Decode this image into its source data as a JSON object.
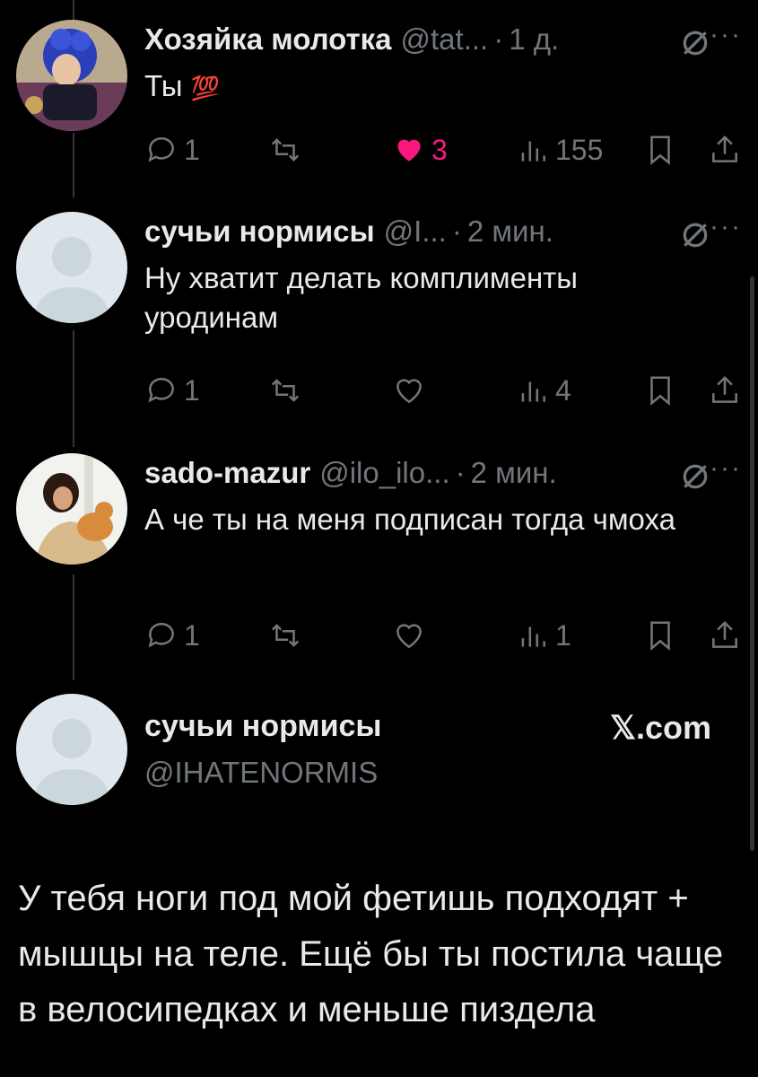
{
  "tweets": [
    {
      "name": "Хозяйка молотка",
      "handle": "@tat...",
      "time": "1 д.",
      "text": "Ты",
      "emoji": "💯",
      "replies": "1",
      "likes": "3",
      "views": "155",
      "liked": true
    },
    {
      "name": "сучьи нормисы",
      "handle": "@I...",
      "time": "2 мин.",
      "text": "Ну хватит делать комплименты уродинам",
      "replies": "1",
      "likes": "",
      "views": "4",
      "liked": false
    },
    {
      "name": "sado-mazur",
      "handle": "@ilo_ilo...",
      "time": "2 мин.",
      "text": "А че ты на меня подписан тогда чмоха",
      "replies": "1",
      "likes": "",
      "views": "1",
      "liked": false
    }
  ],
  "card": {
    "name": "сучьи нормисы",
    "handle": "@IHATENORMIS",
    "brand": "𝕏.com",
    "text": "У тебя ноги под мой фетишь подходят + мышцы на теле. Ещё бы ты постила чаще в велосипедках и меньше пиздела"
  },
  "colors": {
    "background": "#000000",
    "text": "#e7e9ea",
    "muted": "#71767b",
    "like": "#f91880"
  },
  "icons": [
    "reply-icon",
    "retweet-icon",
    "heart-icon",
    "views-icon",
    "bookmark-icon",
    "share-icon",
    "grok-icon",
    "more-icon"
  ]
}
